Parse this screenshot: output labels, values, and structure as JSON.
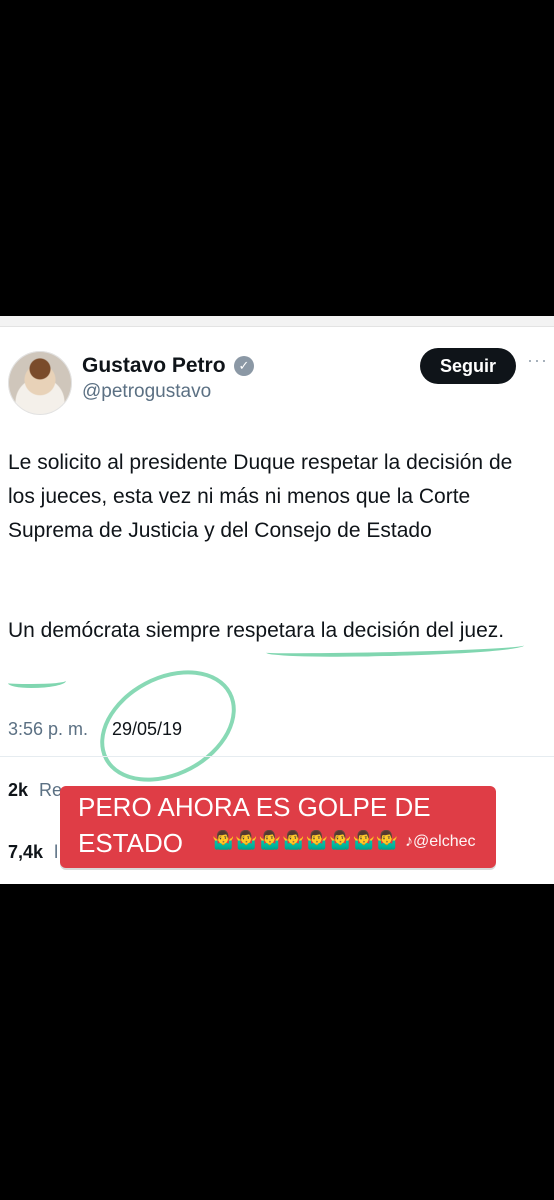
{
  "tweet": {
    "author_name": "Gustavo Petro",
    "verified_glyph": "✓",
    "handle": "@petrogustavo",
    "follow_button": "Seguir",
    "more_glyph": "···",
    "text_p1": "Le solicito al presidente Duque respetar la decisión de los jueces, esta vez ni más ni menos que la Corte Suprema de Justicia y del Consejo de Estado",
    "text_p2": "Un demócrata siempre respetara la decisión del juez.",
    "time": "3:56 p. m.",
    "date": "29/05/19",
    "stats": {
      "retweets_value": "2k",
      "retweets_label": "Re",
      "likes_value": "7,4k",
      "likes_label": "l"
    }
  },
  "overlay": {
    "line1": "PERO AHORA ES GOLPE DE",
    "line2": "ESTADO",
    "emoji_row": "🤷‍♂️🤷‍♂️🤷‍♂️🤷‍♂️🤷‍♂️🤷‍♂️🤷‍♂️🤷‍♂️",
    "watermark": "♪@elchec"
  },
  "colors": {
    "background": "#000000",
    "card": "#ffffff",
    "highlight_green": "#73d2a8",
    "overlay_red": "#df3d46",
    "text_primary": "#0f1419",
    "text_secondary": "#5b7083"
  }
}
